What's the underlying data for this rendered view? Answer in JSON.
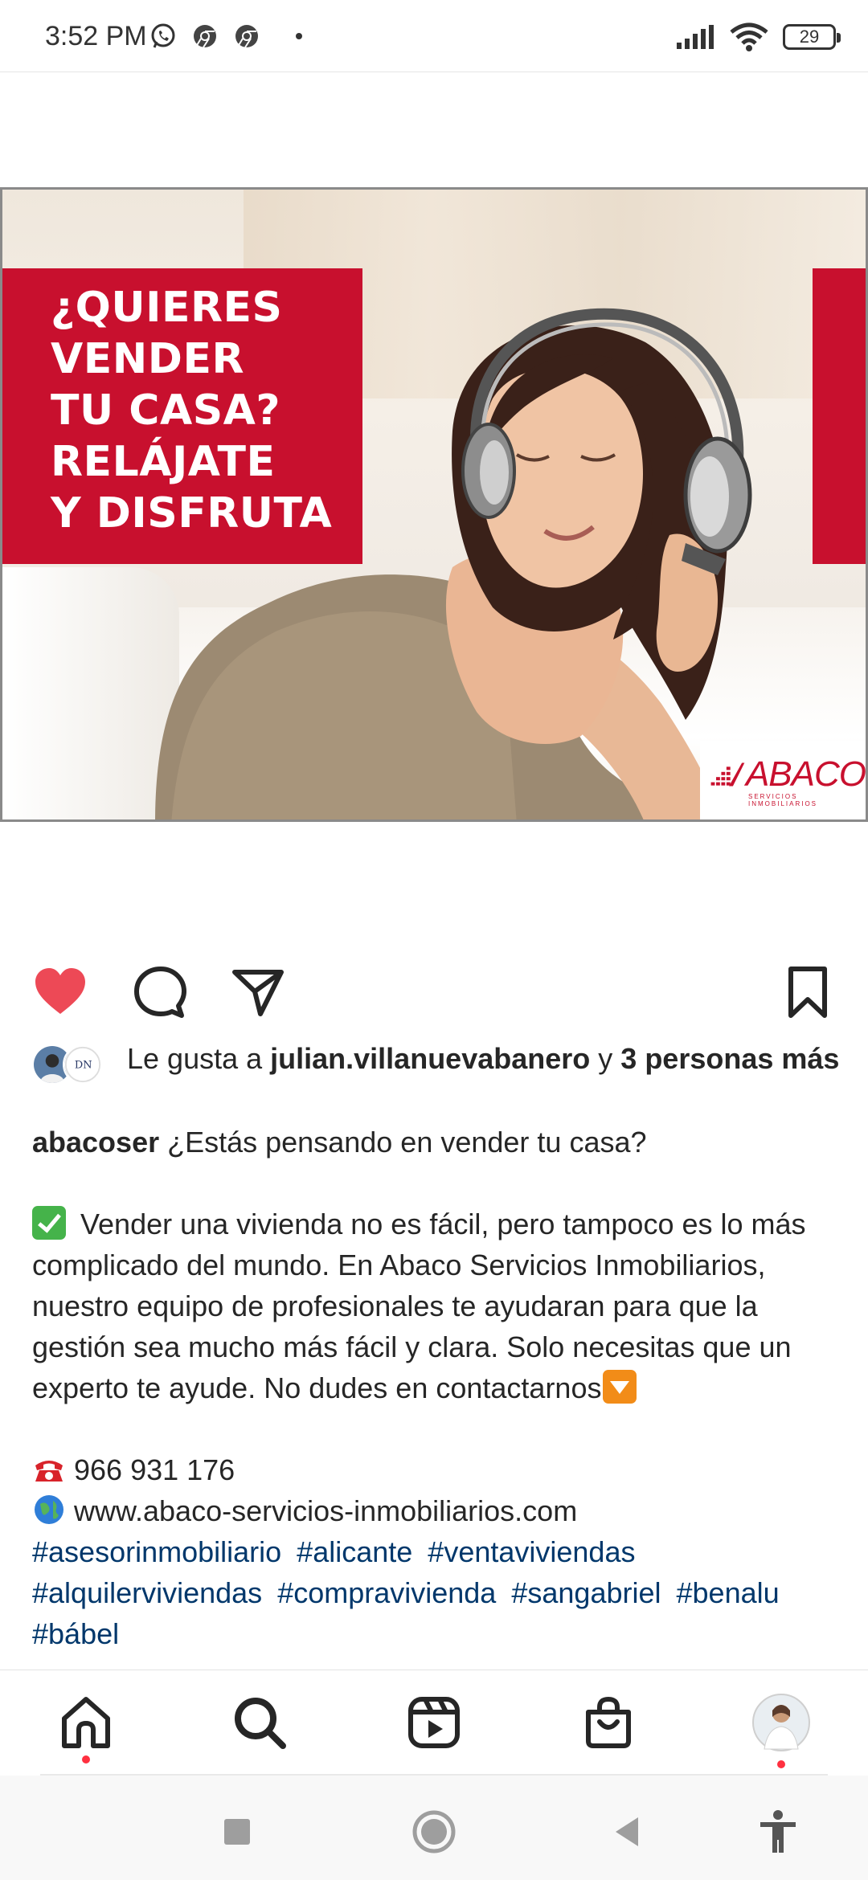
{
  "status_bar": {
    "time": "3:52 PM",
    "app_icons": [
      "whatsapp-icon",
      "chrome-icon",
      "chrome-icon"
    ],
    "battery": "29"
  },
  "post": {
    "image": {
      "headline_lines": [
        "¿QUIERES",
        "VENDER",
        "TU CASA?",
        "RELÁJATE",
        "Y DISFRUTA"
      ],
      "logo_text": "ABACO",
      "logo_subtext": "SERVICIOS INMOBILIARIOS",
      "brand_red": "#c8102e"
    },
    "liked": true,
    "like_color": "#ed4956",
    "likes": {
      "prefix": "Le gusta a ",
      "user": "julian.villanuevabanero",
      "middle": " y ",
      "others": "3 personas más"
    },
    "caption": {
      "username": "abacoser",
      "first_line": " ¿Estás pensando en vender tu casa?",
      "body": " Vender una vivienda no es fácil, pero tampoco es lo más complicado del mundo. En Abaco Servicios Inmobiliarios, nuestro equipo de profesionales te ayudaran para que la gestión sea mucho más fácil y clara. Solo necesitas que un experto te ayude. No dudes en contactarnos",
      "phone": " 966 931 176",
      "website": " www.abaco-servicios-inmobiliarios.com",
      "hashtags": [
        "#asesorinmobiliario",
        "#alicante",
        "#ventaviviendas",
        "#alquilerviviendas",
        "#compravivienda",
        "#sangabriel",
        "#benalu",
        "#bábel"
      ],
      "hashtag_color": "#00376b"
    }
  },
  "bottom_nav": {
    "items": [
      "home-icon",
      "search-icon",
      "reels-icon",
      "shop-icon",
      "profile-avatar"
    ],
    "notification_color": "#ff3040"
  },
  "system_nav": [
    "recents-button",
    "home-button",
    "back-button",
    "accessibility-button"
  ]
}
